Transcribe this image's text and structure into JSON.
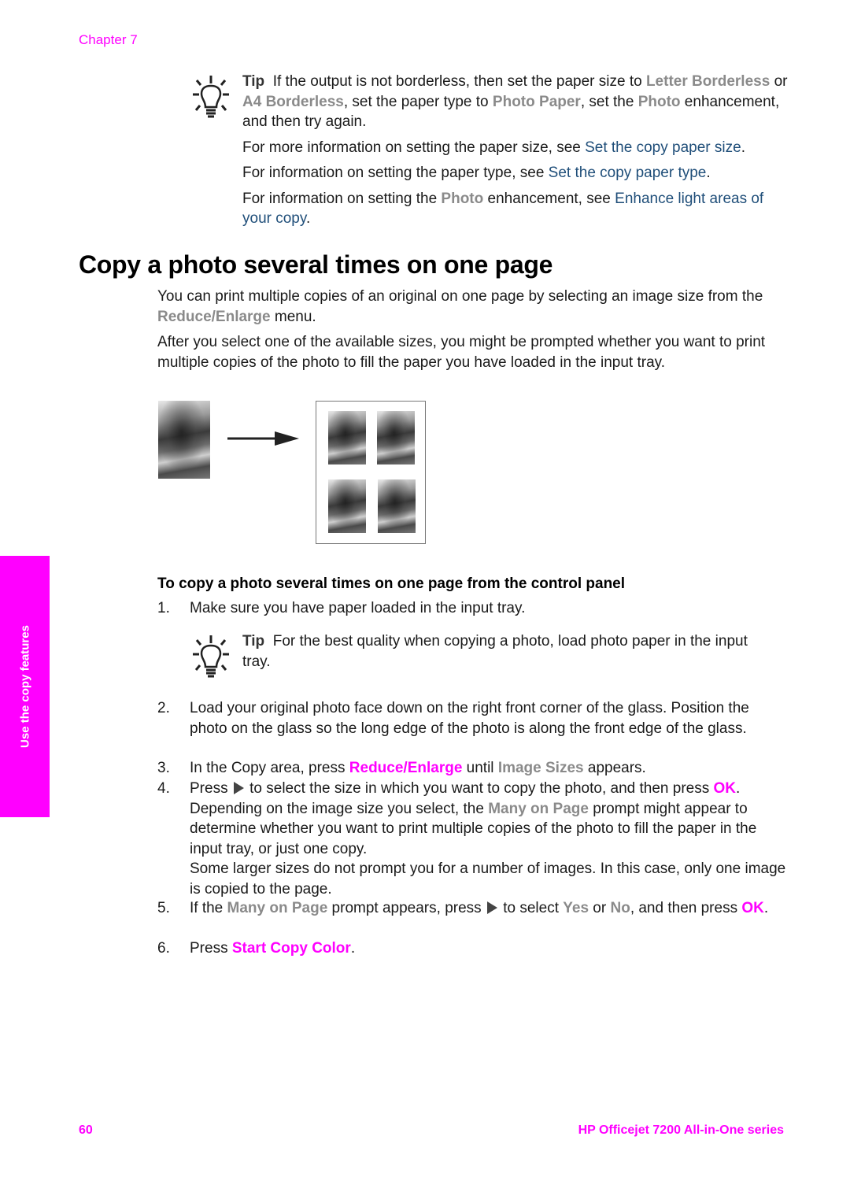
{
  "header": {
    "chapter": "Chapter 7"
  },
  "tip1": {
    "tip_label": "Tip",
    "line1_pre": "If the output is not borderless, then set the paper size to ",
    "letter_borderless": "Letter Borderless",
    "or": " or ",
    "a4_borderless": "A4 Borderless",
    "mid": ", set the paper type to ",
    "photo_paper": "Photo Paper",
    "mid2": ", set the ",
    "photo": "Photo",
    "end": " enhancement, and then try again.",
    "more1_pre": "For more information on setting the paper size, see ",
    "more1_link": "Set the copy paper size",
    "more1_end": ".",
    "more2_pre": "For information on setting the paper type, see ",
    "more2_link": "Set the copy paper type",
    "more2_end": ".",
    "more3_pre": "For information on setting the ",
    "more3_photo": "Photo",
    "more3_mid": " enhancement, see ",
    "more3_link": "Enhance light areas of your copy",
    "more3_end": "."
  },
  "section": {
    "title": "Copy a photo several times on one page",
    "p1_pre": "You can print multiple copies of an original on one page by selecting an image size from the ",
    "p1_term": "Reduce/Enlarge",
    "p1_end": " menu.",
    "p2": "After you select one of the available sizes, you might be prompted whether you want to print multiple copies of the photo to fill the paper you have loaded in the input tray."
  },
  "figure": {
    "original_alt": "tiger photo original",
    "copies_count": 4
  },
  "procedure": {
    "heading": "To copy a photo several times on one page from the control panel",
    "step1_num": "1.",
    "step1": "Make sure you have paper loaded in the input tray.",
    "tip2_label": "Tip",
    "tip2_text": "For the best quality when copying a photo, load photo paper in the input tray.",
    "step2_num": "2.",
    "step2": "Load your original photo face down on the right front corner of the glass. Position the photo on the glass so the long edge of the photo is along the front edge of the glass.",
    "step3_num": "3.",
    "step3_pre": "In the Copy area, press ",
    "step3_btn": "Reduce/Enlarge",
    "step3_mid": " until ",
    "step3_term": "Image Sizes",
    "step3_end": " appears.",
    "step4_num": "4.",
    "step4_pre": "Press ",
    "step4_mid": " to select the size in which you want to copy the photo, and then press ",
    "step4_ok": "OK",
    "step4_mid2": ". Depending on the image size you select, the ",
    "step4_term": "Many on Page",
    "step4_end": " prompt might appear to determine whether you want to print multiple copies of the photo to fill the paper in the input tray, or just one copy.",
    "step4_extra": "Some larger sizes do not prompt you for a number of images. In this case, only one image is copied to the page.",
    "step5_num": "5.",
    "step5_pre": "If the ",
    "step5_term": "Many on Page",
    "step5_mid": " prompt appears, press ",
    "step5_mid2": " to select ",
    "step5_yes": "Yes",
    "step5_or": " or ",
    "step5_no": "No",
    "step5_mid3": ", and then press ",
    "step5_ok": "OK",
    "step5_end": ".",
    "step6_num": "6.",
    "step6_pre": "Press ",
    "step6_btn": "Start Copy Color",
    "step6_end": "."
  },
  "side_tab": {
    "label": "Use the copy features"
  },
  "footer": {
    "page_number": "60",
    "product": "HP Officejet 7200 All-in-One series"
  },
  "colors": {
    "accent": "#ff00ff",
    "link": "#1f4e79",
    "term": "#8a8a8a"
  }
}
